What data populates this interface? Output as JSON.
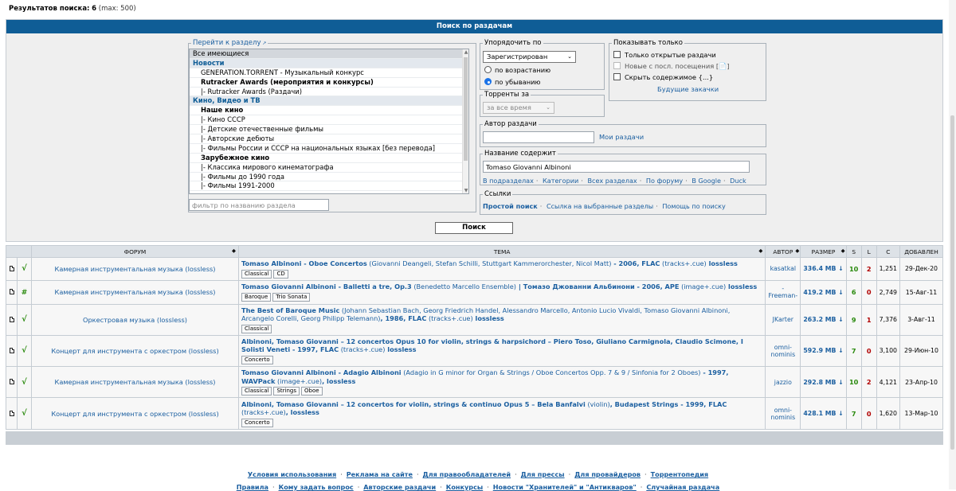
{
  "result": {
    "label": "Результатов поиска:",
    "count": "6",
    "max": "(max: 500)"
  },
  "search": {
    "header": "Поиск по раздачам",
    "forum_legend": "Перейти к разделу",
    "forum_items": [
      {
        "label": "Все имеющиеся",
        "kind": "selected"
      },
      {
        "label": "Новости",
        "kind": "cat"
      },
      {
        "label": "GENERATION.TORRENT - Музыкальный конкурс",
        "kind": "sub"
      },
      {
        "label": "Rutracker Awards (мероприятия и конкурсы)",
        "kind": "group"
      },
      {
        "label": "|- Rutracker Awards (Раздачи)",
        "kind": "sub"
      },
      {
        "label": "Кино, Видео и ТВ",
        "kind": "cat"
      },
      {
        "label": "Наше кино",
        "kind": "group"
      },
      {
        "label": "|- Кино СССР",
        "kind": "sub"
      },
      {
        "label": "|- Детские отечественные фильмы",
        "kind": "sub"
      },
      {
        "label": "|- Авторские дебюты",
        "kind": "sub"
      },
      {
        "label": "|- Фильмы России и СССР на национальных языках [без перевода]",
        "kind": "sub"
      },
      {
        "label": "Зарубежное кино",
        "kind": "group"
      },
      {
        "label": "|- Классика мирового кинематографа",
        "kind": "sub"
      },
      {
        "label": "|- Фильмы до 1990 года",
        "kind": "sub"
      },
      {
        "label": "|- Фильмы 1991-2000",
        "kind": "sub"
      }
    ],
    "forum_filter_placeholder": "фильтр по названию раздела",
    "sort_legend": "Упорядочить по",
    "sort_value": "Зарегистрирован",
    "order_asc": "по возрастанию",
    "order_desc": "по убыванию",
    "period_legend": "Торренты за",
    "period_value": "за все время",
    "show_legend": "Показывать только",
    "show_open": "Только открытые раздачи",
    "show_new": "Новые с посл. посещения [📄]",
    "show_hide": "Скрыть содержимое {...}",
    "future": "Будущие закачки",
    "author_legend": "Автор раздачи",
    "author_value": "",
    "my_releases": "Мои раздачи",
    "title_legend": "Название содержит",
    "title_value": "Tomaso Giovanni Albinoni",
    "title_links": [
      "В подразделах",
      "Категории",
      "Всех разделах",
      "По форуму",
      "В Google",
      "Duck"
    ],
    "links_legend": "Ссылки",
    "links": [
      "Простой поиск",
      "Ссылка на выбранные разделы",
      "Помощь по поиску"
    ],
    "button": "Поиск"
  },
  "table": {
    "headers": {
      "forum": "ФОРУМ",
      "topic": "ТЕМА",
      "author": "АВТОР",
      "size": "РАЗМЕР",
      "s": "S",
      "l": "L",
      "c": "C",
      "added": "ДОБАВЛЕН"
    },
    "rows": [
      {
        "status": "√",
        "forum": "Камерная инструментальная музыка (lossless)",
        "title": "Tomaso Albinoni - Oboe Concertos",
        "extra": " (Giovanni Deangeli, Stefan Schilli, Stuttgart Kammerorchester, Nicol Matt)",
        "title2": " - 2006, FLAC",
        "extra2": " (tracks+.cue)",
        "title3": " lossless",
        "tags": [
          "Classical",
          "CD"
        ],
        "author": "kasatkal",
        "size": "336.4 MB ↓",
        "s": "10",
        "l": "2",
        "c": "1,251",
        "date": "29-Дек-20"
      },
      {
        "status": "#",
        "forum": "Камерная инструментальная музыка (lossless)",
        "title": "Tomaso Giovanni Albinoni - Balletti a tre, Op.3",
        "extra": " (Benedetto Marcello Ensemble)",
        "title2": " | Томазо Джованни Альбинони - 2006, APE",
        "extra2": " (image+.cue)",
        "title3": " lossless",
        "tags": [
          "Baroque",
          "Trio Sonata"
        ],
        "author": "-Freeman-",
        "size": "419.2 MB ↓",
        "s": "6",
        "l": "0",
        "c": "2,749",
        "date": "15-Авг-11"
      },
      {
        "status": "√",
        "forum": "Оркестровая музыка (lossless)",
        "title": "The Best of Baroque Music",
        "extra": " (Johann Sebastian Bach, Georg Friedrich Handel, Alessandro Marcello, Antonio Lucio Vivaldi, Tomaso Giovanni Albinoni, Arcangelo Corelli, Georg Philipp Telemann)",
        "title2": ", 1986, FLAC",
        "extra2": " (tracks+.cue)",
        "title3": " lossless",
        "tags": [
          "Classical"
        ],
        "author": "JKarter",
        "size": "263.2 MB ↓",
        "s": "9",
        "l": "1",
        "c": "7,376",
        "date": "3-Авг-11"
      },
      {
        "status": "√",
        "forum": "Концерт для инструмента с оркестром (lossless)",
        "title": "Albinoni, Tomaso Giovanni – 12 concertos Opus 10 for violin, strings & harpsichord – Piero Toso, Giuliano Carmignola, Claudio Scimone, I Solisti Veneti - 1997, FLAC",
        "extra": "",
        "title2": "",
        "extra2": " (tracks+.cue)",
        "title3": " lossless",
        "tags": [
          "Concerto"
        ],
        "author": "omni-nominis",
        "size": "592.9 MB ↓",
        "s": "7",
        "l": "0",
        "c": "3,100",
        "date": "29-Июн-10"
      },
      {
        "status": "√",
        "forum": "Камерная инструментальная музыка (lossless)",
        "title": "Tomaso Giovanni Albinoni - Adagio Albinoni",
        "extra": " (Adagio in G minor for Organ & Strings / Oboe Concertos Opp. 7 & 9 / Sinfonia for 2 Oboes)",
        "title2": " - 1997, WAVPack",
        "extra2": " (image+.cue)",
        "title3": ", lossless",
        "tags": [
          "Classical",
          "Strings",
          "Oboe"
        ],
        "author": "jazzio",
        "size": "292.8 MB ↓",
        "s": "10",
        "l": "2",
        "c": "4,121",
        "date": "23-Апр-10"
      },
      {
        "status": "√",
        "forum": "Концерт для инструмента с оркестром (lossless)",
        "title": "Albinoni, Tomaso Giovanni – 12 concertos for violin, strings & continuo Opus 5 – Bela Banfalvi",
        "extra": " (violin)",
        "title2": ", Budapest Strings - 1999, FLAC",
        "extra2": " (tracks+.cue)",
        "title3": ", lossless",
        "tags": [
          "Concerto"
        ],
        "author": "omni-nominis",
        "size": "428.1 MB ↓",
        "s": "7",
        "l": "0",
        "c": "1,620",
        "date": "13-Мар-10"
      }
    ]
  },
  "footer": {
    "line1": [
      "Условия использования",
      "Реклама на сайте",
      "Для правообладателей",
      "Для прессы",
      "Для провайдеров",
      "Торрентопедия"
    ],
    "line2": [
      "Правила",
      "Кому задать вопрос",
      "Авторские раздачи",
      "Конкурсы",
      "Новости \"Хранителей\" и \"Антикваров\"",
      "Случайная раздача"
    ]
  }
}
